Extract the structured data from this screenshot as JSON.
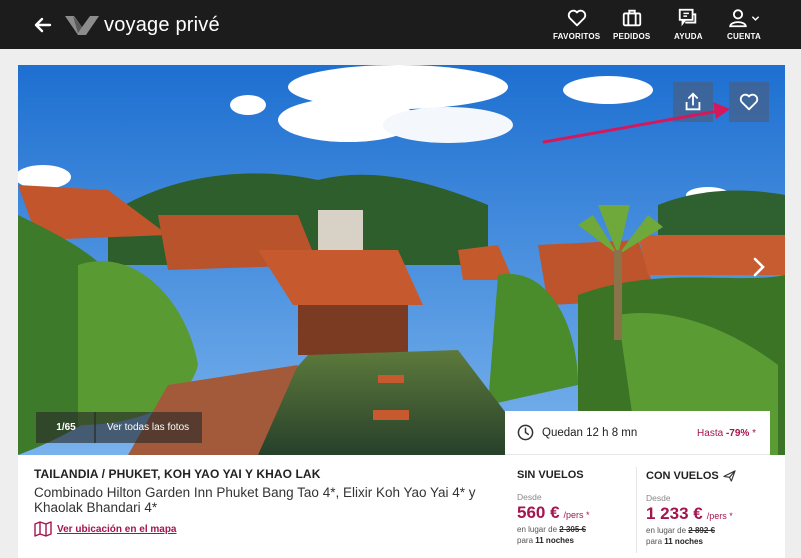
{
  "header": {
    "logo_text": "voyage privé",
    "nav": [
      {
        "label": "FAVORITOS",
        "icon": "heart-icon"
      },
      {
        "label": "PEDIDOS",
        "icon": "suitcase-icon"
      },
      {
        "label": "AYUDA",
        "icon": "help-chat-icon"
      },
      {
        "label": "CUENTA",
        "icon": "user-icon"
      }
    ]
  },
  "hero": {
    "photo_count": "1/65",
    "all_photos_label": "Ver todas las fotos"
  },
  "offer": {
    "destination": "TAILANDIA / PHUKET, KOH YAO YAI Y KHAO LAK",
    "hotels": "Combinado Hilton Garden Inn Phuket Bang Tao 4*, Elixir Koh Yao Yai 4* y Khaolak Bhandari 4*",
    "map_link": "Ver ubicación en el mapa"
  },
  "pricing": {
    "timer": "Quedan 12 h 8 mn",
    "discount_prefix": "Hasta",
    "discount_value": "-79%",
    "discount_suffix": "*",
    "without_flights": {
      "title": "SIN VUELOS",
      "from": "Desde",
      "price": "560 €",
      "per": "/pers *",
      "instead_prefix": "en lugar de",
      "instead_price": "2 305 €",
      "nights_prefix": "para",
      "nights": "11 noches"
    },
    "with_flights": {
      "title": "CON VUELOS",
      "from": "Desde",
      "price": "1 233 €",
      "per": "/pers *",
      "instead_prefix": "en lugar de",
      "instead_price": "2 892 €",
      "nights_prefix": "para",
      "nights": "11 noches"
    }
  },
  "colors": {
    "header_bg": "#1c1c1c",
    "accent": "#a4144e",
    "annotation_arrow": "#d3195c"
  }
}
